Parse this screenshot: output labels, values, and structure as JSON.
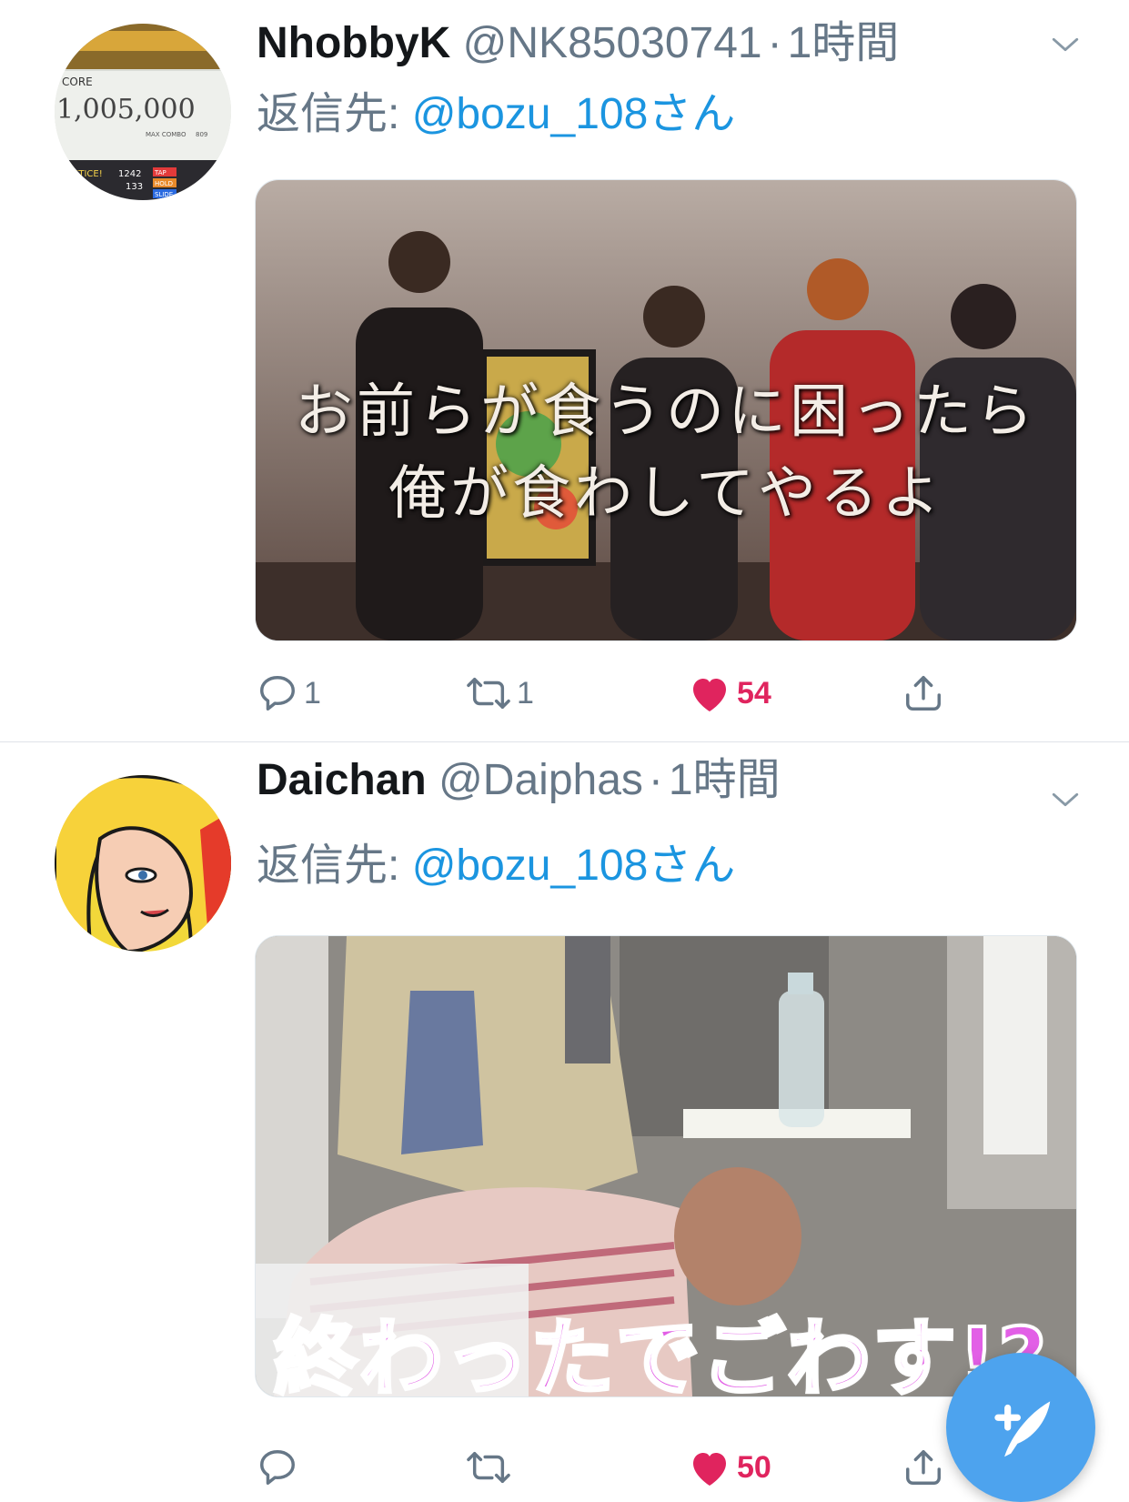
{
  "timeline": {
    "tweets": [
      {
        "display_name": "NhobbyK",
        "handle": "@NK85030741",
        "separator": "·",
        "time": "1時間",
        "reply_prefix": "返信先:",
        "reply_to": "@bozu_108さん",
        "media_caption_line1": "お前らが食うのに困ったら",
        "media_caption_line2": "俺が食わしてやるよ",
        "avatar_score": "1,005,000",
        "avatar_label": "CORE",
        "avatar_combo_label": "MAX COMBO",
        "avatar_combo_value": "809",
        "avatar_row1_label": "STICE!",
        "avatar_row1_value": "1242",
        "avatar_row2_value": "133",
        "avatar_tap": "TAP",
        "avatar_hold": "HOLD",
        "avatar_slide": "SLIDE",
        "reply_count": "1",
        "retweet_count": "1",
        "like_count": "54",
        "liked": true
      },
      {
        "display_name": "Daichan",
        "handle": "@Daiphas",
        "separator": "·",
        "time": "1時間",
        "reply_prefix": "返信先:",
        "reply_to": "@bozu_108さん",
        "media_caption": "終わったでごわす!?",
        "reply_count": "",
        "retweet_count": "",
        "like_count": "50",
        "liked": true
      }
    ]
  },
  "colors": {
    "accent": "#1b95e0",
    "like": "#e0245e",
    "secondary_text": "#667787",
    "primary_text": "#14171a",
    "fab": "#4da3ee"
  },
  "icons": {
    "reply": "reply-icon",
    "retweet": "retweet-icon",
    "like": "heart-icon",
    "share": "share-icon",
    "caret": "chevron-down-icon",
    "compose": "compose-tweet-icon"
  }
}
